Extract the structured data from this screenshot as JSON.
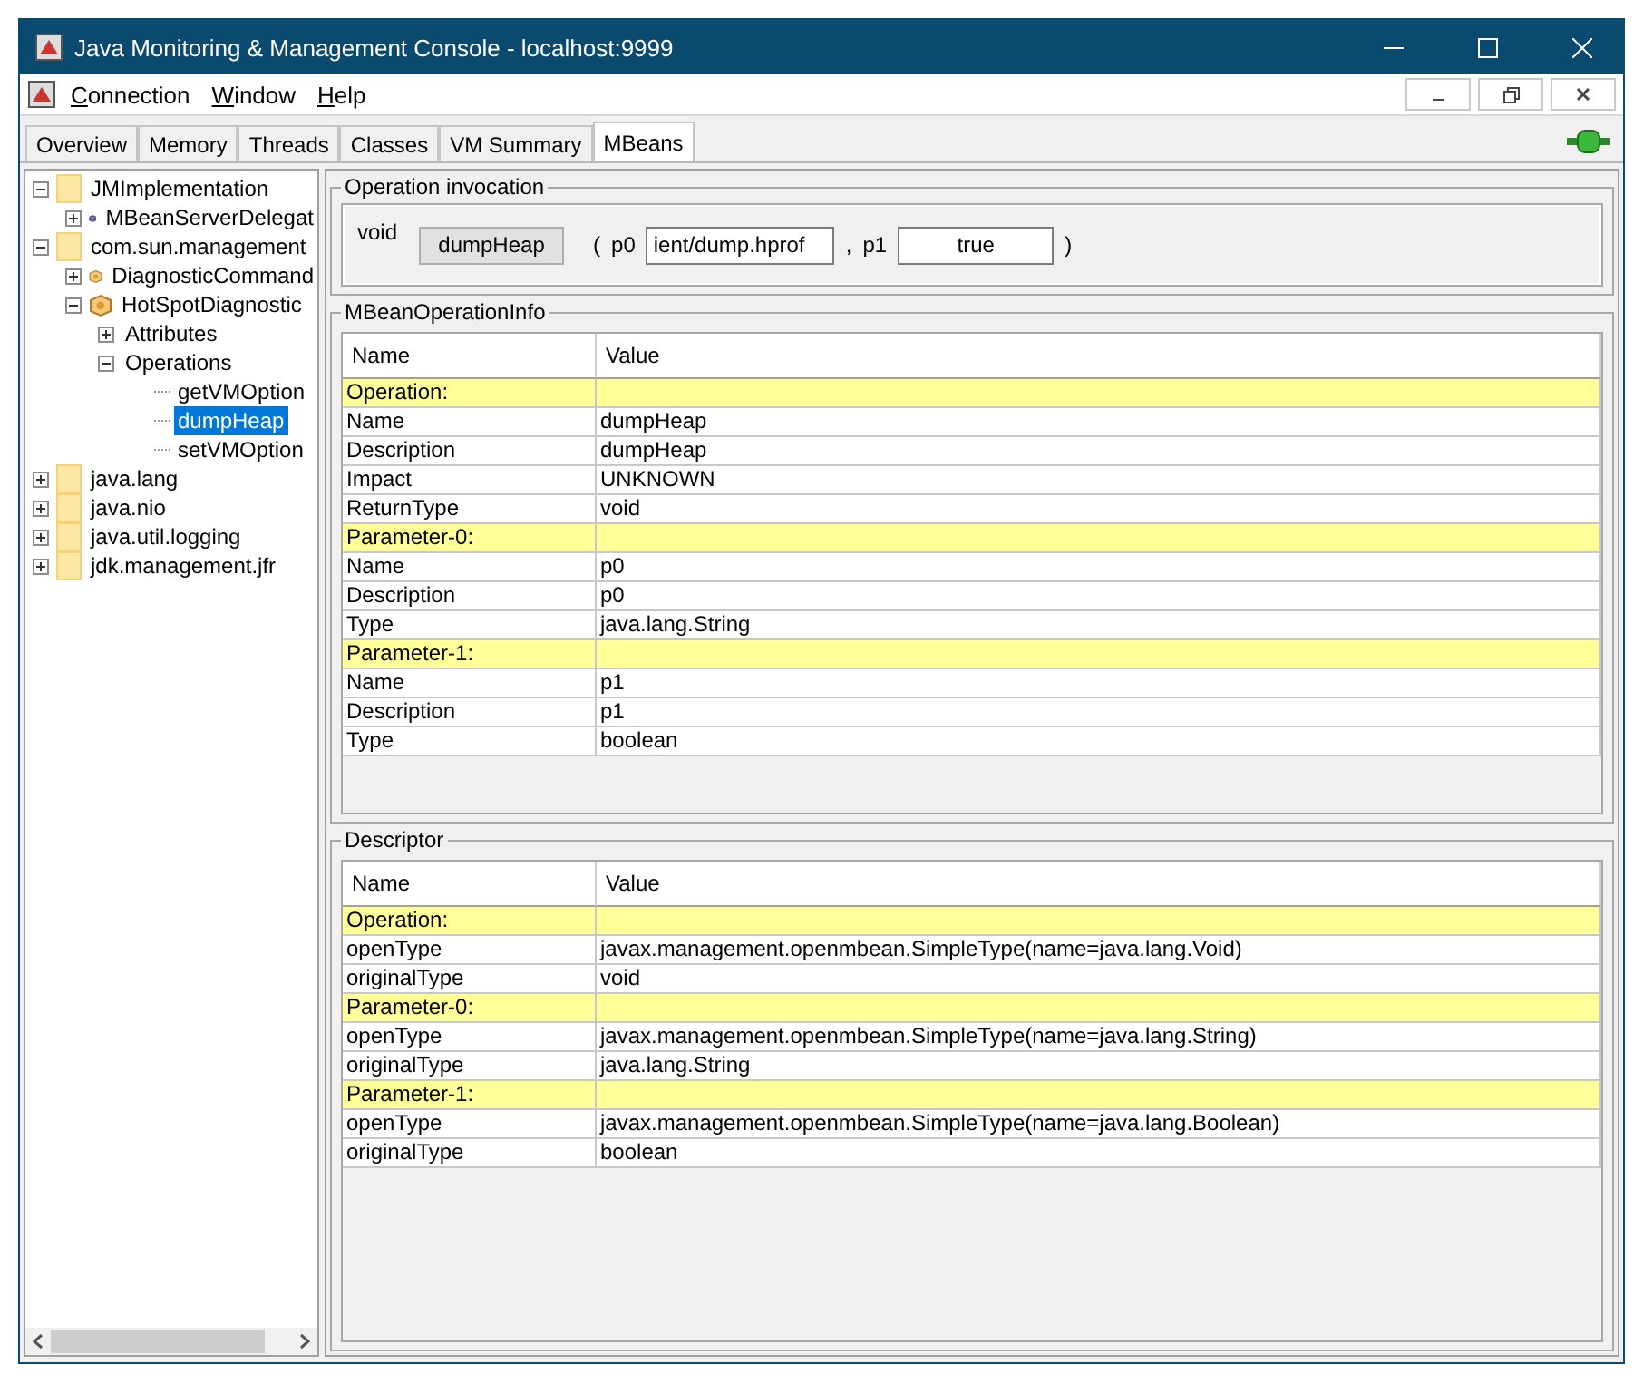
{
  "window": {
    "title": "Java Monitoring & Management Console - localhost:9999"
  },
  "menu": [
    {
      "label": "Connection"
    },
    {
      "label": "Window"
    },
    {
      "label": "Help"
    }
  ],
  "tabs": [
    {
      "label": "Overview",
      "selected": false
    },
    {
      "label": "Memory",
      "selected": false
    },
    {
      "label": "Threads",
      "selected": false
    },
    {
      "label": "Classes",
      "selected": false
    },
    {
      "label": "VM Summary",
      "selected": false
    },
    {
      "label": "MBeans",
      "selected": true
    }
  ],
  "tree": [
    {
      "label": "JMImplementation",
      "kind": "folder",
      "expanded": true,
      "selected": false,
      "children": [
        {
          "label": "MBeanServerDelegat",
          "kind": "mbean",
          "expanded": false,
          "selected": false
        }
      ]
    },
    {
      "label": "com.sun.management",
      "kind": "folder",
      "expanded": true,
      "selected": false,
      "children": [
        {
          "label": "DiagnosticCommand",
          "kind": "bean",
          "expanded": false,
          "selected": false
        },
        {
          "label": "HotSpotDiagnostic",
          "kind": "bean",
          "expanded": true,
          "selected": false,
          "children": [
            {
              "label": "Attributes",
              "expanded": false,
              "selected": false
            },
            {
              "label": "Operations",
              "expanded": true,
              "selected": false,
              "children": [
                {
                  "label": "getVMOption",
                  "kind": "leaf",
                  "selected": false
                },
                {
                  "label": "dumpHeap",
                  "kind": "leaf",
                  "selected": true
                },
                {
                  "label": "setVMOption",
                  "kind": "leaf",
                  "selected": false
                }
              ]
            }
          ]
        }
      ]
    },
    {
      "label": "java.lang",
      "kind": "folder",
      "expanded": false,
      "selected": false
    },
    {
      "label": "java.nio",
      "kind": "folder",
      "expanded": false,
      "selected": false
    },
    {
      "label": "java.util.logging",
      "kind": "folder",
      "expanded": false,
      "selected": false
    },
    {
      "label": "jdk.management.jfr",
      "kind": "folder",
      "expanded": false,
      "selected": false
    }
  ],
  "invocation": {
    "title": "Operation invocation",
    "return_type": "void",
    "button": "dumpHeap",
    "open": "(",
    "params": [
      {
        "name": "p0",
        "value": "ient/dump.hprof"
      },
      {
        "name": "p1",
        "value": "true",
        "sep": ","
      }
    ],
    "close": ")"
  },
  "info": {
    "title": "MBeanOperationInfo",
    "columns": [
      "Name",
      "Value"
    ],
    "rows": [
      {
        "kind": "section",
        "name": "Operation:"
      },
      {
        "kind": "field",
        "name": "Name",
        "value": "dumpHeap"
      },
      {
        "kind": "field",
        "name": "Description",
        "value": "dumpHeap"
      },
      {
        "kind": "field",
        "name": "Impact",
        "value": "UNKNOWN"
      },
      {
        "kind": "field",
        "name": "ReturnType",
        "value": "void"
      },
      {
        "kind": "section",
        "name": "Parameter-0:"
      },
      {
        "kind": "field",
        "name": "Name",
        "value": "p0"
      },
      {
        "kind": "field",
        "name": "Description",
        "value": "p0"
      },
      {
        "kind": "field",
        "name": "Type",
        "value": "java.lang.String"
      },
      {
        "kind": "section",
        "name": "Parameter-1:"
      },
      {
        "kind": "field",
        "name": "Name",
        "value": "p1"
      },
      {
        "kind": "field",
        "name": "Description",
        "value": "p1"
      },
      {
        "kind": "field",
        "name": "Type",
        "value": "boolean"
      }
    ]
  },
  "descriptor": {
    "title": "Descriptor",
    "columns": [
      "Name",
      "Value"
    ],
    "rows": [
      {
        "kind": "section",
        "name": "Operation:"
      },
      {
        "kind": "field",
        "name": "openType",
        "value": "javax.management.openmbean.SimpleType(name=java.lang.Void)"
      },
      {
        "kind": "field",
        "name": "originalType",
        "value": "void"
      },
      {
        "kind": "section",
        "name": "Parameter-0:"
      },
      {
        "kind": "field",
        "name": "openType",
        "value": "javax.management.openmbean.SimpleType(name=java.lang.String)"
      },
      {
        "kind": "field",
        "name": "originalType",
        "value": "java.lang.String"
      },
      {
        "kind": "section",
        "name": "Parameter-1:"
      },
      {
        "kind": "field",
        "name": "openType",
        "value": "javax.management.openmbean.SimpleType(name=java.lang.Boolean)"
      },
      {
        "kind": "field",
        "name": "originalType",
        "value": "boolean"
      }
    ]
  }
}
